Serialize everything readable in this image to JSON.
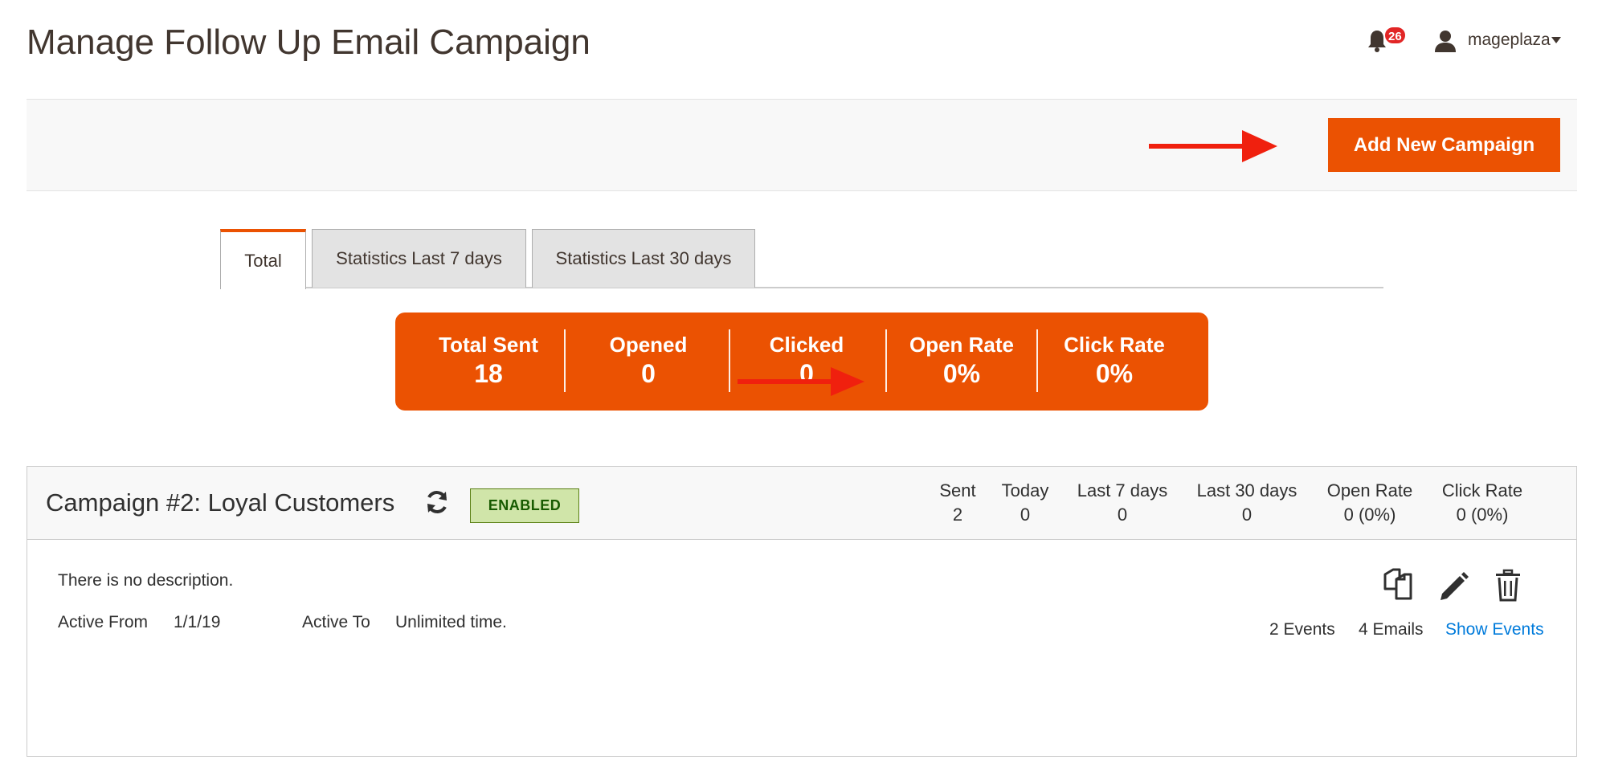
{
  "header": {
    "title": "Manage Follow Up Email Campaign",
    "notification_count": "26",
    "username": "mageplaza",
    "icons": [
      "bell-icon",
      "user-icon",
      "chevron-down-icon"
    ]
  },
  "action_bar": {
    "add_button_label": "Add New Campaign"
  },
  "tabs": [
    {
      "label": "Total",
      "active": true
    },
    {
      "label": "Statistics Last 7 days",
      "active": false
    },
    {
      "label": "Statistics Last 30 days",
      "active": false
    }
  ],
  "stats": [
    {
      "label": "Total Sent",
      "value": "18"
    },
    {
      "label": "Opened",
      "value": "0"
    },
    {
      "label": "Clicked",
      "value": "0"
    },
    {
      "label": "Open Rate",
      "value": "0%"
    },
    {
      "label": "Click Rate",
      "value": "0%"
    }
  ],
  "campaign": {
    "name": "Campaign #2: Loyal Customers",
    "status": "ENABLED",
    "metrics": [
      {
        "label": "Sent",
        "value": "2"
      },
      {
        "label": "Today",
        "value": "0"
      },
      {
        "label": "Last 7 days",
        "value": "0"
      },
      {
        "label": "Last 30 days",
        "value": "0"
      },
      {
        "label": "Open Rate",
        "value": "0 (0%)"
      },
      {
        "label": "Click Rate",
        "value": "0 (0%)"
      }
    ],
    "description": "There is no description.",
    "active_from_label": "Active From",
    "active_from_value": "1/1/19",
    "active_to_label": "Active To",
    "active_to_value": "Unlimited time.",
    "events_count": "2 Events",
    "emails_count": "4 Emails",
    "show_events_label": "Show Events"
  },
  "colors": {
    "accent": "#eb5202",
    "annotation_arrow": "#f0200e",
    "link": "#007bdb",
    "enabled_bg": "#d0e5a9",
    "enabled_text": "#185b00"
  }
}
